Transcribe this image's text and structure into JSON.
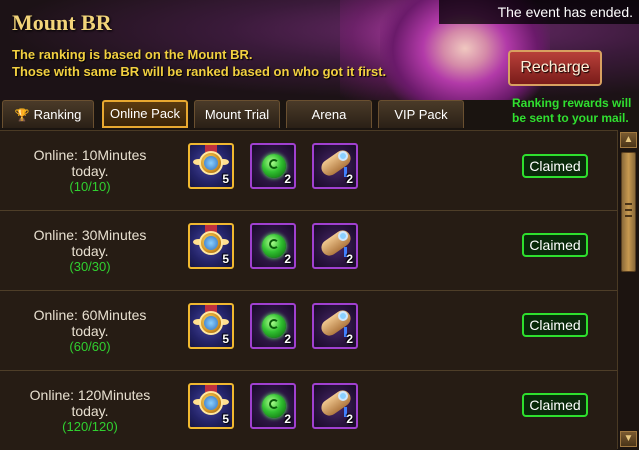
{
  "banner": {
    "title": "Mount BR",
    "desc_line1": "The ranking is based on the Mount BR.",
    "desc_line2": "Those with same BR will be ranked based on who got it first.",
    "event_status": "The event has ended.",
    "recharge_label": "Recharge",
    "rank_note_line1": "Ranking rewards will",
    "rank_note_line2": "be sent to your mail."
  },
  "tabs": [
    {
      "label": "Ranking",
      "icon": "trophy-icon",
      "active": false
    },
    {
      "label": "Online Pack",
      "active": true
    },
    {
      "label": "Mount Trial",
      "active": false
    },
    {
      "label": "Arena",
      "active": false
    },
    {
      "label": "VIP Pack",
      "active": false
    }
  ],
  "rows": [
    {
      "title_line1": "Online: 10Minutes",
      "title_line2": "today.",
      "progress": "(10/10)",
      "items": [
        {
          "icon": "winged-medal-icon",
          "qty": "5"
        },
        {
          "icon": "green-gem-icon",
          "qty": "2"
        },
        {
          "icon": "scroll-icon",
          "qty": "2"
        }
      ],
      "status": "Claimed"
    },
    {
      "title_line1": "Online: 30Minutes",
      "title_line2": "today.",
      "progress": "(30/30)",
      "items": [
        {
          "icon": "winged-medal-icon",
          "qty": "5"
        },
        {
          "icon": "green-gem-icon",
          "qty": "2"
        },
        {
          "icon": "scroll-icon",
          "qty": "2"
        }
      ],
      "status": "Claimed"
    },
    {
      "title_line1": "Online: 60Minutes",
      "title_line2": "today.",
      "progress": "(60/60)",
      "items": [
        {
          "icon": "winged-medal-icon",
          "qty": "5"
        },
        {
          "icon": "green-gem-icon",
          "qty": "2"
        },
        {
          "icon": "scroll-icon",
          "qty": "2"
        }
      ],
      "status": "Claimed"
    },
    {
      "title_line1": "Online: 120Minutes",
      "title_line2": "today.",
      "progress": "(120/120)",
      "items": [
        {
          "icon": "winged-medal-icon",
          "qty": "5"
        },
        {
          "icon": "green-gem-icon",
          "qty": "2"
        },
        {
          "icon": "scroll-icon",
          "qty": "2"
        }
      ],
      "status": "Claimed"
    }
  ],
  "colors": {
    "title": "#f2d47a",
    "desc": "#f2d040",
    "progress": "#30d030",
    "claimed_border": "#2ee02e"
  }
}
